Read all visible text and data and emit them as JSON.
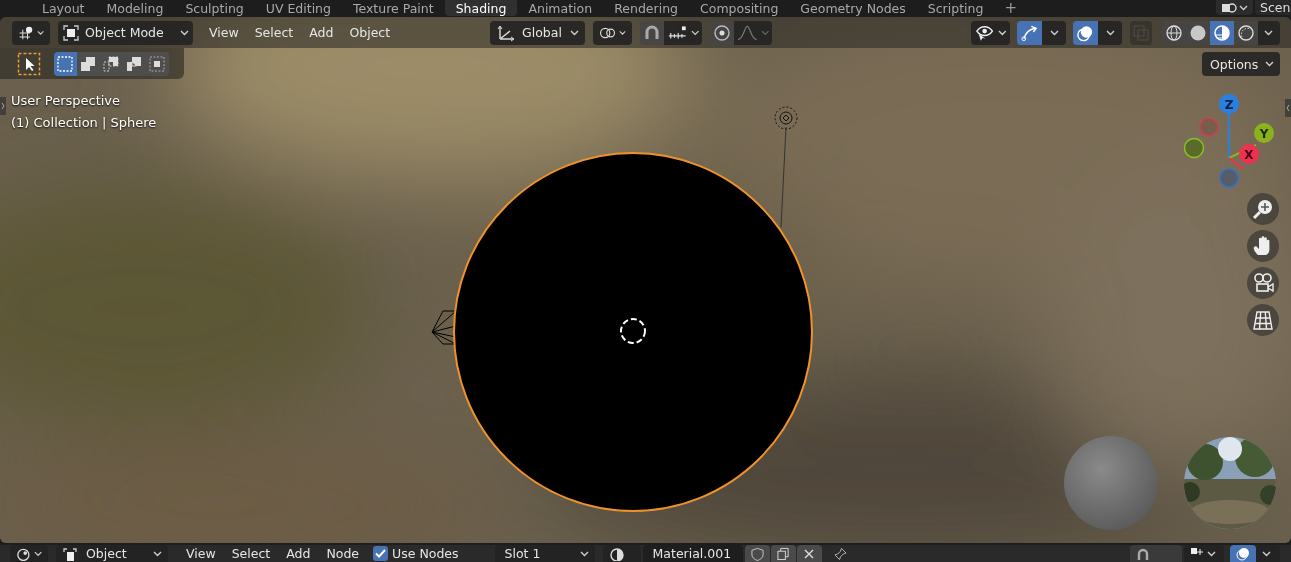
{
  "workspace_tabs": [
    {
      "label": "Layout",
      "selected": false
    },
    {
      "label": "Modeling",
      "selected": false
    },
    {
      "label": "Sculpting",
      "selected": false
    },
    {
      "label": "UV Editing",
      "selected": false
    },
    {
      "label": "Texture Paint",
      "selected": false
    },
    {
      "label": "Shading",
      "selected": true
    },
    {
      "label": "Animation",
      "selected": false
    },
    {
      "label": "Rendering",
      "selected": false
    },
    {
      "label": "Compositing",
      "selected": false
    },
    {
      "label": "Geometry Nodes",
      "selected": false
    },
    {
      "label": "Scripting",
      "selected": false
    }
  ],
  "add_workspace": "+",
  "scene": {
    "label": "Scen"
  },
  "viewport_header": {
    "mode": "Object Mode",
    "menus": [
      "View",
      "Select",
      "Add",
      "Object"
    ],
    "orientation": "Global",
    "options": "Options",
    "toggles": [
      {
        "kind": "gizmo",
        "on": true
      },
      {
        "kind": "overlays",
        "on": true
      }
    ],
    "xray": {
      "disabled": true
    },
    "shading_modes": [
      {
        "kind": "wireframe",
        "selected": false
      },
      {
        "kind": "solid",
        "selected": false
      },
      {
        "kind": "material",
        "selected": true
      },
      {
        "kind": "rendered",
        "selected": false
      }
    ]
  },
  "select_modes": [
    {
      "kind": "new",
      "selected": true
    },
    {
      "kind": "extend",
      "selected": false
    },
    {
      "kind": "subtract",
      "selected": false
    },
    {
      "kind": "invert",
      "selected": false
    },
    {
      "kind": "intersect",
      "selected": false
    }
  ],
  "viewport_info": [
    "User Perspective",
    "(1) Collection | Sphere"
  ],
  "axes": {
    "x": "X",
    "y": "Y",
    "z": "Z"
  },
  "node_header": {
    "object": "Object",
    "menus": [
      "View",
      "Select",
      "Add",
      "Node"
    ],
    "use_nodes": {
      "label": "Use Nodes",
      "checked": true
    },
    "slot": "Slot 1",
    "material": "Material.001",
    "overlays": {
      "on": true
    }
  }
}
